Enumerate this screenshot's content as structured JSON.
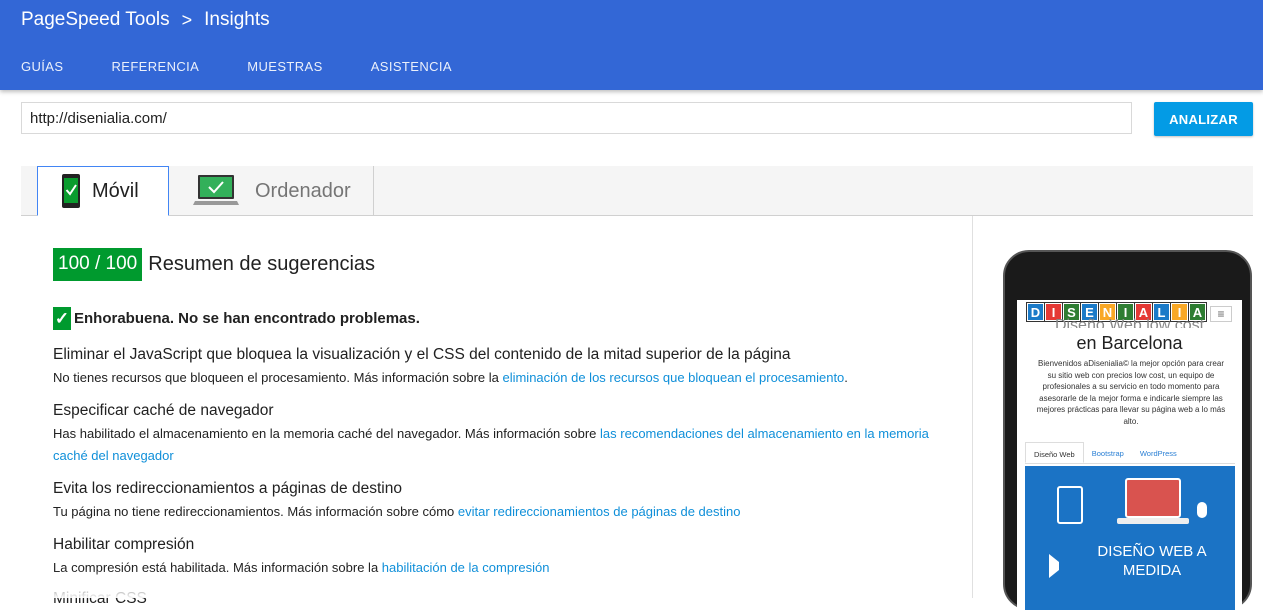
{
  "header": {
    "brand": "PageSpeed Tools",
    "separator": ">",
    "section": "Insights",
    "nav": [
      "GUÍAS",
      "REFERENCIA",
      "MUESTRAS",
      "ASISTENCIA"
    ]
  },
  "search": {
    "url_value": "http://disenialia.com/",
    "analyze_label": "ANALIZAR"
  },
  "tabs": {
    "mobile_label": "Móvil",
    "desktop_label": "Ordenador"
  },
  "summary": {
    "score": "100 / 100",
    "title": "Resumen de sugerencias",
    "congrats": "Enhorabuena. No se han encontrado problemas."
  },
  "rules": [
    {
      "title": "Eliminar el JavaScript que bloquea la visualización y el CSS del contenido de la mitad superior de la página",
      "desc": "No tienes recursos que bloqueen el procesamiento. Más información sobre la ",
      "link": "eliminación de los recursos que bloquean el procesamiento",
      "after": "."
    },
    {
      "title": "Especificar caché de navegador",
      "desc": "Has habilitado el almacenamiento en la memoria caché del navegador. Más información sobre ",
      "link": "las recomendaciones del almacenamiento en la memoria caché del navegador",
      "after": ""
    },
    {
      "title": "Evita los redireccionamientos a páginas de destino",
      "desc": "Tu página no tiene redireccionamientos. Más información sobre cómo ",
      "link": "evitar redireccionamientos de páginas de destino",
      "after": ""
    },
    {
      "title": "Habilitar compresión",
      "desc": "La compresión está habilitada. Más información sobre la ",
      "link": "habilitación de la compresión",
      "after": ""
    },
    {
      "title": "Minificar CSS",
      "desc": "",
      "link": "",
      "after": ""
    }
  ],
  "preview": {
    "logo_letters": [
      "D",
      "I",
      "S",
      "E",
      "N",
      "I",
      "A",
      "L",
      "I",
      "A"
    ],
    "logo_colors": [
      "#1a7ac8",
      "#e53935",
      "#2e7d32",
      "#1a7ac8",
      "#f9a825",
      "#2e7d32",
      "#e53935",
      "#1a7ac8",
      "#f9a825",
      "#2e7d32"
    ],
    "menu_icon": "hamburger-icon",
    "subtitle": "Diseño Web low cost",
    "title": "en Barcelona",
    "text": "Bienvenidos aDisenialia© la mejor opción para crear su sitio web con precios low cost, un equipo de profesionales a su servicio en todo momento para asesorarle de la mejor forma e indicarle siempre las mejores prácticas para llevar su página web a lo más alto.",
    "tabs": [
      "Diseño Web",
      "Bootstrap",
      "WordPress"
    ],
    "banner_text": "DISEÑO WEB A MEDIDA"
  },
  "colors": {
    "header": "#3367d6",
    "accent": "#039be5",
    "score": "#009a2e",
    "link": "#0f8fd9"
  }
}
